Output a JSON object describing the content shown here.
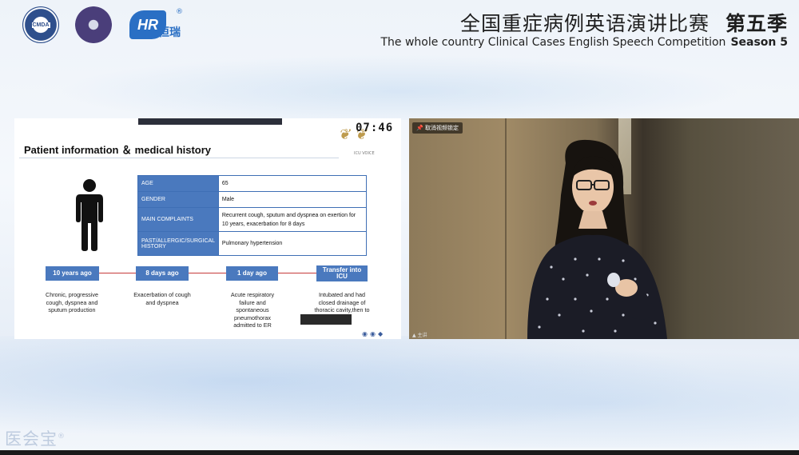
{
  "header": {
    "logos": {
      "cmda": "CMDA",
      "hengrui_reg": "®",
      "hengrui_text": "恒瑞"
    },
    "title_cn": "全国重症病例英语演讲比赛",
    "season_cn": "第五季",
    "title_en": "The whole country Clinical Cases English Speech Competition",
    "season_en": "Season 5"
  },
  "slide": {
    "title": "Patient information ＆ medical history",
    "timer": "07:46",
    "event_logo_sub": "ICU VOICE",
    "table": [
      {
        "label": "AGE",
        "value": "65"
      },
      {
        "label": "GENDER",
        "value": "Male"
      },
      {
        "label": "MAIN COMPLAINTS",
        "value": "Recurrent cough, sputum and dyspnea on exertion for 10 years, exacerbation for 8 days"
      },
      {
        "label": "PAST/ALLERGIC/SURGICAL HISTORY",
        "value": "Pulmonary hypertension"
      }
    ],
    "timeline": [
      {
        "label": "10 years ago",
        "text": "Chronic, progressive cough, dyspnea and sputum production"
      },
      {
        "label": "8 days ago",
        "text": "Exacerbation of cough and dyspnea"
      },
      {
        "label": "1 day ago",
        "text": "Acute respiratory failure and spontaneous pneumothorax admitted to ER"
      },
      {
        "label": "Transfer into ICU",
        "text": "Intubated and had closed drainage of thoracic cavity,then to ICU"
      }
    ]
  },
  "video": {
    "pin_label": "取消视频锁定",
    "cam_label": "▲ 主讲"
  },
  "watermark": {
    "text": "医会宝",
    "reg": "®"
  },
  "colors": {
    "table_label_bg": "#4a79be",
    "timeline_line": "#c63a3a",
    "accent_blue": "#2a6fc4"
  }
}
